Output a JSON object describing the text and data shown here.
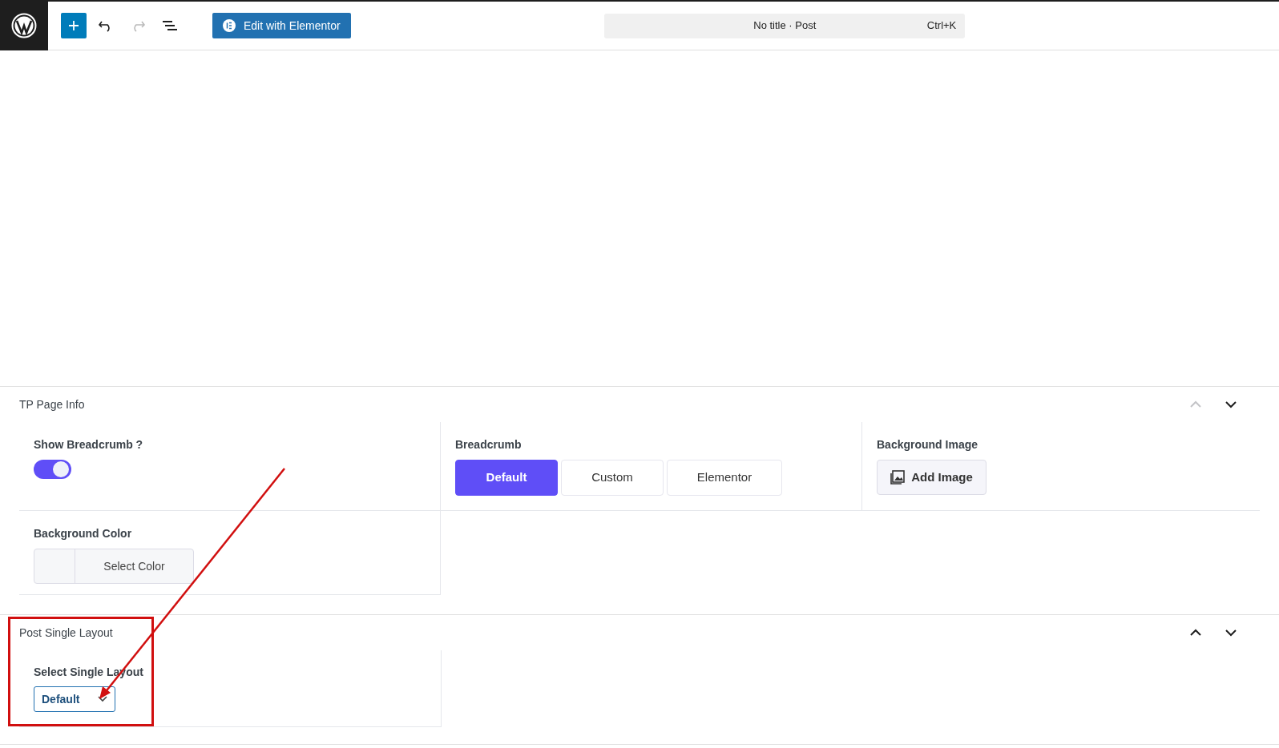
{
  "toolbar": {
    "undo_disabled": false,
    "redo_disabled": true,
    "elementor_button": "Edit with Elementor",
    "command_bar": {
      "title": "No title · Post",
      "shortcut": "Ctrl+K"
    }
  },
  "sections": [
    {
      "title": "TP Page Info",
      "move_up_disabled": true,
      "move_down_disabled": false
    },
    {
      "title": "Post Single Layout",
      "move_up_disabled": false,
      "move_down_disabled": false
    }
  ],
  "page_info": {
    "show_breadcrumb": {
      "label": "Show Breadcrumb ?",
      "on": true
    },
    "breadcrumb": {
      "label": "Breadcrumb",
      "options": [
        {
          "label": "Default",
          "selected": true
        },
        {
          "label": "Custom",
          "selected": false
        },
        {
          "label": "Elementor",
          "selected": false
        }
      ]
    },
    "background_image": {
      "label": "Background Image",
      "button": "Add Image"
    },
    "background_color": {
      "label": "Background Color",
      "button": "Select Color"
    }
  },
  "single_layout": {
    "label": "Select Single Layout",
    "value": "Default"
  }
}
